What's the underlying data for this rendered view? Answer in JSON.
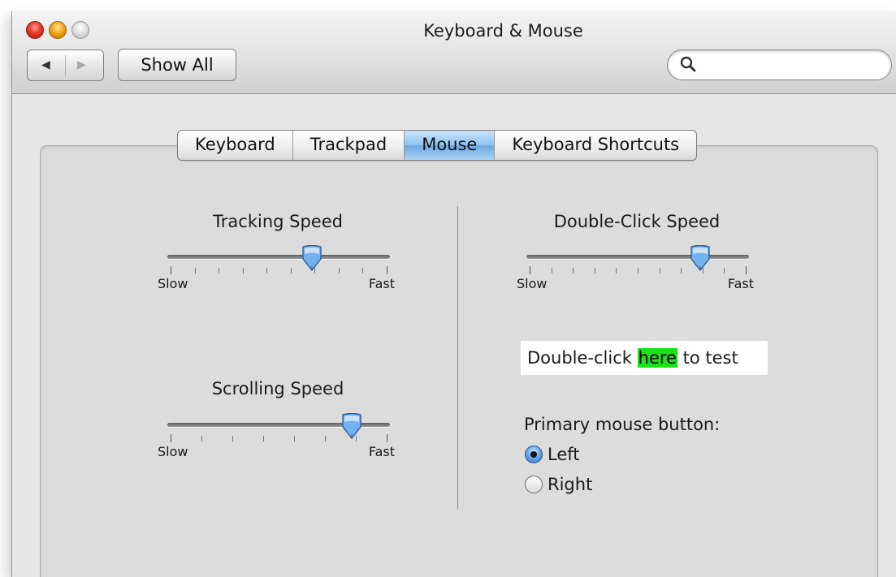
{
  "window": {
    "title": "Keyboard & Mouse"
  },
  "toolbar": {
    "back_icon": "◀",
    "forward_icon": "▶",
    "show_all_label": "Show All",
    "search": {
      "icon": "⚲",
      "placeholder": "",
      "value": ""
    }
  },
  "tabs": [
    {
      "label": "Keyboard",
      "active": false
    },
    {
      "label": "Trackpad",
      "active": false
    },
    {
      "label": "Mouse",
      "active": true
    },
    {
      "label": "Keyboard Shortcuts",
      "active": false
    }
  ],
  "tracking_speed": {
    "label": "Tracking Speed",
    "min_label": "Slow",
    "max_label": "Fast",
    "level": 0.65,
    "ticks": 10
  },
  "scrolling_speed": {
    "label": "Scrolling Speed",
    "min_label": "Slow",
    "max_label": "Fast",
    "level": 0.83,
    "ticks": 8
  },
  "double_click_speed": {
    "label": "Double-Click Speed",
    "min_label": "Slow",
    "max_label": "Fast",
    "level": 0.78,
    "ticks": 11
  },
  "test_area": {
    "prefix": "Double-click ",
    "highlight": "here",
    "suffix": " to test",
    "highlight_color": "#1ae317"
  },
  "primary_button": {
    "label": "Primary mouse button:",
    "options": [
      {
        "label": "Left",
        "checked": true
      },
      {
        "label": "Right",
        "checked": false
      }
    ]
  }
}
